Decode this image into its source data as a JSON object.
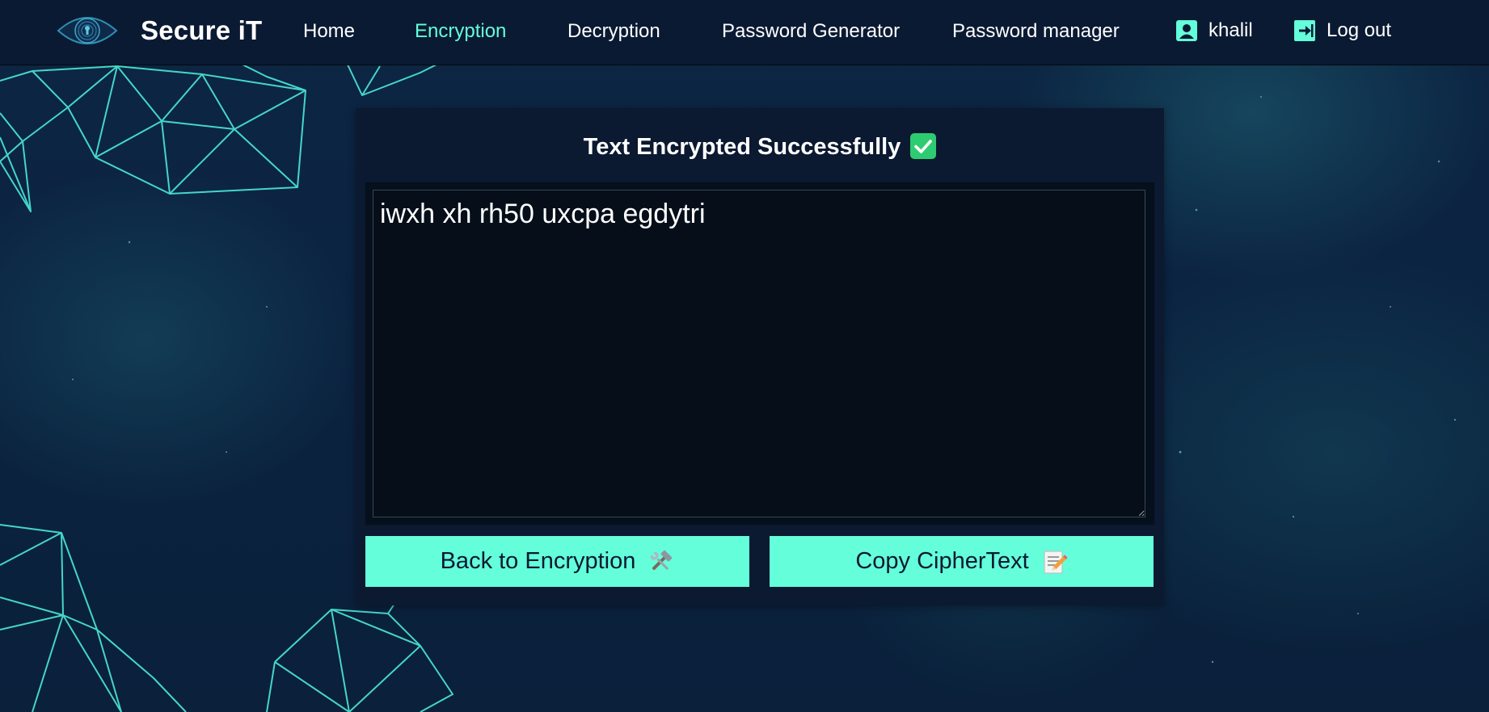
{
  "colors": {
    "accent": "#64ffda",
    "navbar_bg": "#0b1a33",
    "card_bg": "#0b1931",
    "success_check": "#2ecc71"
  },
  "navbar": {
    "brand": "Secure iT",
    "logo_icon": "eye-fingerprint-logo-icon",
    "links": [
      {
        "label": "Home",
        "active": false
      },
      {
        "label": "Encryption",
        "active": true
      },
      {
        "label": "Decryption",
        "active": false
      },
      {
        "label": "Password Generator",
        "active": false
      },
      {
        "label": "Password manager",
        "active": false
      }
    ],
    "user": {
      "label": "khalil",
      "icon": "user-badge-icon"
    },
    "logout": {
      "label": "Log out",
      "icon": "logout-arrow-icon"
    }
  },
  "result": {
    "title": "Text Encrypted Successfully",
    "title_icon": "check-mark-icon",
    "ciphertext": "iwxh xh rh50 uxcpa egdytri",
    "buttons": {
      "back_label": "Back to Encryption",
      "back_icon": "tools-icon",
      "copy_label": "Copy CipherText",
      "copy_icon": "memo-pencil-icon"
    }
  }
}
